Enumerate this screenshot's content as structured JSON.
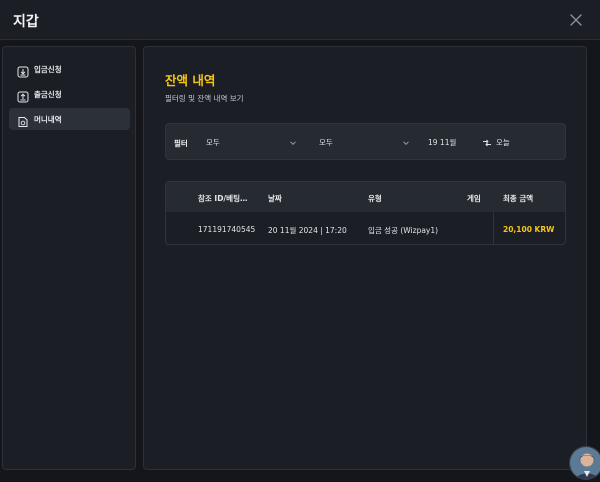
{
  "header": {
    "title": "지갑"
  },
  "sidebar": {
    "items": [
      {
        "label": "입금신청",
        "icon": "deposit-icon"
      },
      {
        "label": "출금신청",
        "icon": "withdraw-icon"
      },
      {
        "label": "머니내역",
        "icon": "money-history-icon",
        "active": true
      }
    ]
  },
  "main": {
    "title": "잔액 내역",
    "subtitle": "필터링 및 잔액 내역 보기",
    "filter": {
      "label": "필터",
      "select1": "모두",
      "select2": "모두",
      "date_from": "19 11월",
      "date_to": "오늘"
    },
    "table": {
      "headers": [
        "참조 ID/베팅…",
        "날짜",
        "유형",
        "게임",
        "최종 금액"
      ],
      "rows": [
        {
          "ref": "171191740545",
          "date": "20 11월 2024 | 17:20",
          "type": "입금 성공 (Wizpay1)",
          "game": "",
          "amount": "20,100 KRW"
        }
      ]
    }
  },
  "colors": {
    "accent": "#f5c518",
    "background": "#14161b",
    "panel": "#1b1e25"
  }
}
